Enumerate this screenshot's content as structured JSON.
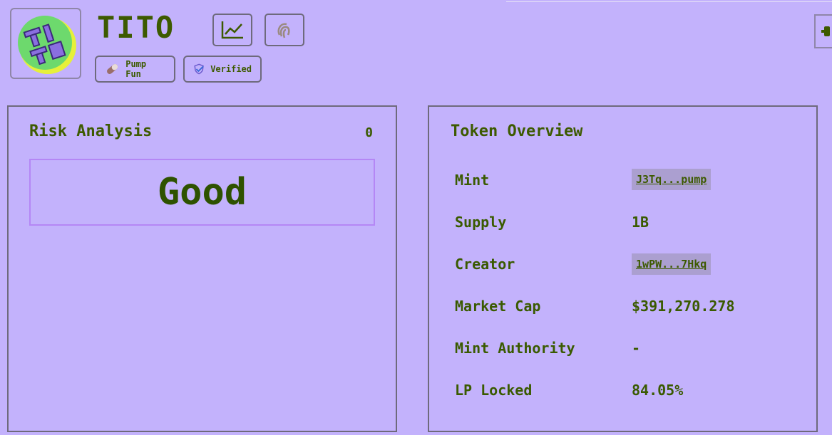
{
  "header": {
    "title": "TITO",
    "logo_text": "TI TO",
    "badges": [
      {
        "label": "Pump Fun",
        "icon": "pill-icon"
      },
      {
        "label": "Verified",
        "icon": "verified-shield-icon"
      }
    ],
    "icons": [
      "chart-icon",
      "fingerprint-icon",
      "exit-icon"
    ]
  },
  "risk": {
    "title": "Risk Analysis",
    "score": "0",
    "rating": "Good"
  },
  "overview": {
    "title": "Token Overview",
    "rows": [
      {
        "label": "Mint",
        "value": "J3Tq...pump"
      },
      {
        "label": "Supply",
        "value": "1B"
      },
      {
        "label": "Creator",
        "value": "1wPW...7Hkq"
      },
      {
        "label": "Market Cap",
        "value": "$391,270.278"
      },
      {
        "label": "Mint Authority",
        "value": "-"
      },
      {
        "label": "LP Locked",
        "value": "84.05%"
      }
    ]
  },
  "colors": {
    "background": "#c3b2fc",
    "text": "#3d5a00",
    "accent_border": "#b487f5",
    "logo_circle": "#6dd96d",
    "logo_ring": "#e6f03a"
  }
}
